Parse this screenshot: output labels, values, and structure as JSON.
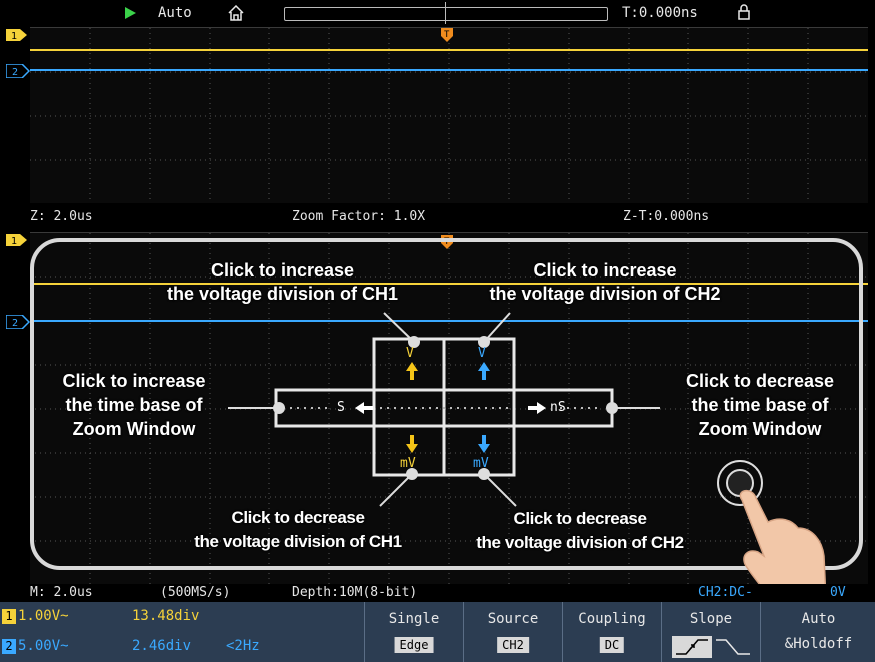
{
  "topbar": {
    "trigger_mode": "Auto",
    "trigger_time": "T:0.000ns"
  },
  "zoom_info": {
    "zoom_time_base": "Z: 2.0us",
    "zoom_factor": "Zoom Factor: 1.0X",
    "zoom_trigger_time": "Z-T:0.000ns"
  },
  "status": {
    "main_time_base": "M: 2.0us",
    "sample_rate": "(500MS/s)",
    "depth": "Depth:10M(8-bit)",
    "trigger_info": "CH2:DC-",
    "trigger_level": "0V"
  },
  "channels": [
    {
      "badge": "1",
      "scale": "1.00V~",
      "position": "13.48div",
      "extra": "",
      "color": "#f5d23a"
    },
    {
      "badge": "2",
      "scale": "5.00V~",
      "position": "2.46div",
      "extra": "<2Hz",
      "color": "#3aa9ff"
    }
  ],
  "markers": {
    "ch1": "1",
    "ch2": "2",
    "trigger": "T"
  },
  "menu": {
    "single_label": "Single",
    "single_value": "Edge",
    "source_label": "Source",
    "source_value": "CH2",
    "coupling_label": "Coupling",
    "coupling_value": "DC",
    "slope_label": "Slope",
    "holdoff_label_1": "Auto",
    "holdoff_label_2": "&Holdoff"
  },
  "zoom_control": {
    "up_unit": "V",
    "down_unit": "mV",
    "left_unit": "S",
    "right_unit": "nS"
  },
  "callouts": {
    "ch1_inc_1": "Click to increase",
    "ch1_inc_2": "the voltage division of CH1",
    "ch2_inc_1": "Click to increase",
    "ch2_inc_2": "the voltage division of CH2",
    "time_inc_1": "Click to increase",
    "time_inc_2": "the time base of",
    "time_inc_3": "Zoom Window",
    "time_dec_1": "Click to decrease",
    "time_dec_2": "the time base of",
    "time_dec_3": "Zoom Window",
    "ch1_dec_1": "Click to decrease",
    "ch1_dec_2": "the voltage division of CH1",
    "ch2_dec_1": "Click to decrease",
    "ch2_dec_2": "the voltage division of CH2"
  },
  "colors": {
    "ch1": "#f5d23a",
    "ch2": "#3aa9ff",
    "trigger": "#f08c1e",
    "menu_bg": "#2c3d52"
  }
}
